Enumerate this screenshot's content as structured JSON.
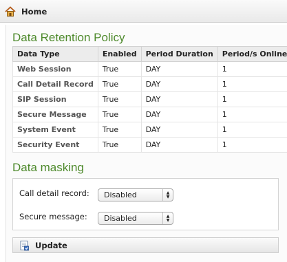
{
  "topbar": {
    "home_label": "Home"
  },
  "retention": {
    "title": "Data Retention Policy",
    "columns": [
      "Data Type",
      "Enabled",
      "Period Duration",
      "Period/s Online"
    ],
    "rows": [
      [
        "Web Session",
        "True",
        "DAY",
        "1"
      ],
      [
        "Call Detail Record",
        "True",
        "DAY",
        "1"
      ],
      [
        "SIP Session",
        "True",
        "DAY",
        "1"
      ],
      [
        "Secure Message",
        "True",
        "DAY",
        "1"
      ],
      [
        "System Event",
        "True",
        "DAY",
        "1"
      ],
      [
        "Security Event",
        "True",
        "DAY",
        "1"
      ]
    ]
  },
  "masking": {
    "title": "Data masking",
    "call_detail_record": {
      "label": "Call detail record:",
      "value": "Disabled"
    },
    "secure_message": {
      "label": "Secure message:",
      "value": "Disabled"
    }
  },
  "actions": {
    "update_label": "Update"
  },
  "icons": {
    "home": "home-icon",
    "update": "update-icon",
    "select_arrows": "up-down-arrows-icon"
  },
  "colors": {
    "heading": "#4e8a2c"
  }
}
